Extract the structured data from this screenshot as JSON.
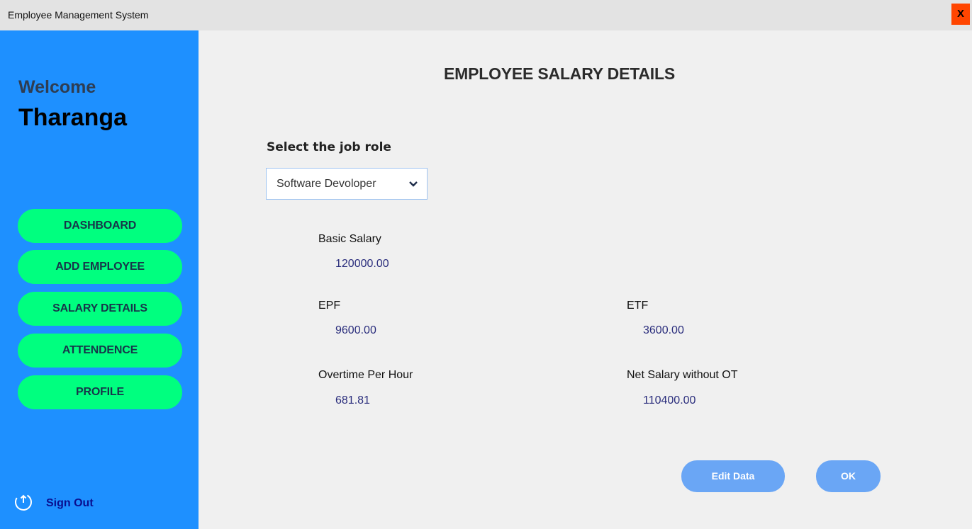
{
  "window": {
    "title": "Employee Management System",
    "close_label": "X"
  },
  "sidebar": {
    "welcome": "Welcome",
    "username": "Tharanga",
    "nav": [
      {
        "label": "DASHBOARD"
      },
      {
        "label": "ADD EMPLOYEE"
      },
      {
        "label": "SALARY DETAILS"
      },
      {
        "label": "ATTENDENCE"
      },
      {
        "label": "PROFILE"
      }
    ],
    "signout_label": "Sign Out",
    "signout_icon": "power-icon"
  },
  "main": {
    "title": "EMPLOYEE SALARY DETAILS",
    "job_role_label": "Select the job role",
    "job_role_selected": "Software Devoloper",
    "fields": {
      "basic_salary": {
        "label": "Basic Salary",
        "value": "120000.00"
      },
      "epf": {
        "label": "EPF",
        "value": "9600.00"
      },
      "etf": {
        "label": "ETF",
        "value": "3600.00"
      },
      "overtime": {
        "label": "Overtime Per Hour",
        "value": "681.81"
      },
      "net_salary": {
        "label": "Net Salary without OT",
        "value": "110400.00"
      }
    },
    "buttons": {
      "edit": "Edit Data",
      "ok": "OK"
    }
  },
  "colors": {
    "sidebar_bg": "#1e90ff",
    "nav_button_bg": "#00ff7f",
    "action_button_bg": "#6aa6f5",
    "close_button_bg": "#ff4500",
    "value_text": "#2a2d7c"
  }
}
